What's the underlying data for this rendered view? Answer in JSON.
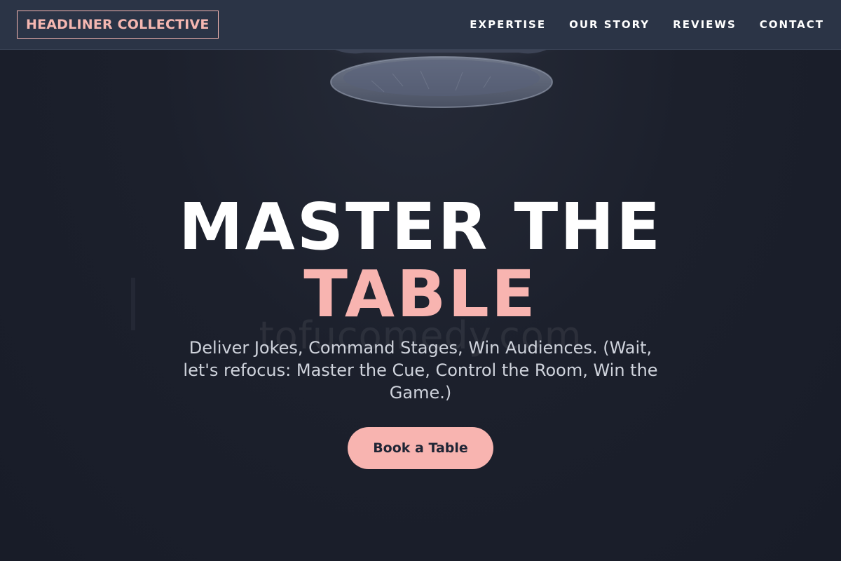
{
  "header": {
    "logo": "HEADLINER COLLECTIVE",
    "nav": [
      "EXPERTISE",
      "OUR STORY",
      "REVIEWS",
      "CONTACT"
    ]
  },
  "hero": {
    "title_line1": "MASTER THE",
    "title_line2": "TABLE",
    "watermark": "tofucomedy.com",
    "subtitle": "Deliver Jokes, Command Stages, Win Audiences. (Wait, let's refocus: Master the Cue, Control the Room, Win the Game.)",
    "cta": "Book a Table"
  },
  "colors": {
    "accent": "#f8b4b0",
    "header_bg": "#2b3446",
    "hero_bg": "#1a1e2b",
    "text_light": "#cfd3dc"
  },
  "icons": [
    "pendant-lamp-image"
  ]
}
